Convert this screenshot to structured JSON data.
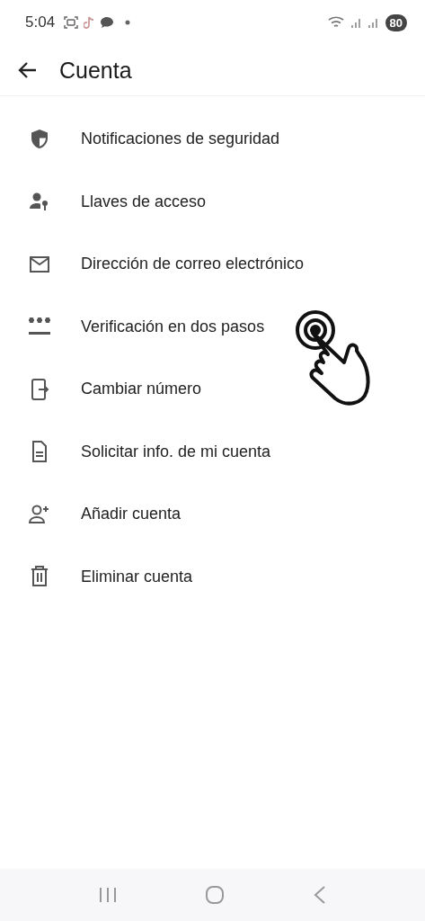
{
  "status_bar": {
    "time": "5:04",
    "battery": "80"
  },
  "header": {
    "title": "Cuenta"
  },
  "items": [
    {
      "label": "Notificaciones de seguridad"
    },
    {
      "label": "Llaves de acceso"
    },
    {
      "label": "Dirección de correo electrónico"
    },
    {
      "label": "Verificación en dos pasos"
    },
    {
      "label": "Cambiar número"
    },
    {
      "label": "Solicitar info. de mi cuenta"
    },
    {
      "label": "Añadir cuenta"
    },
    {
      "label": "Eliminar cuenta"
    }
  ]
}
